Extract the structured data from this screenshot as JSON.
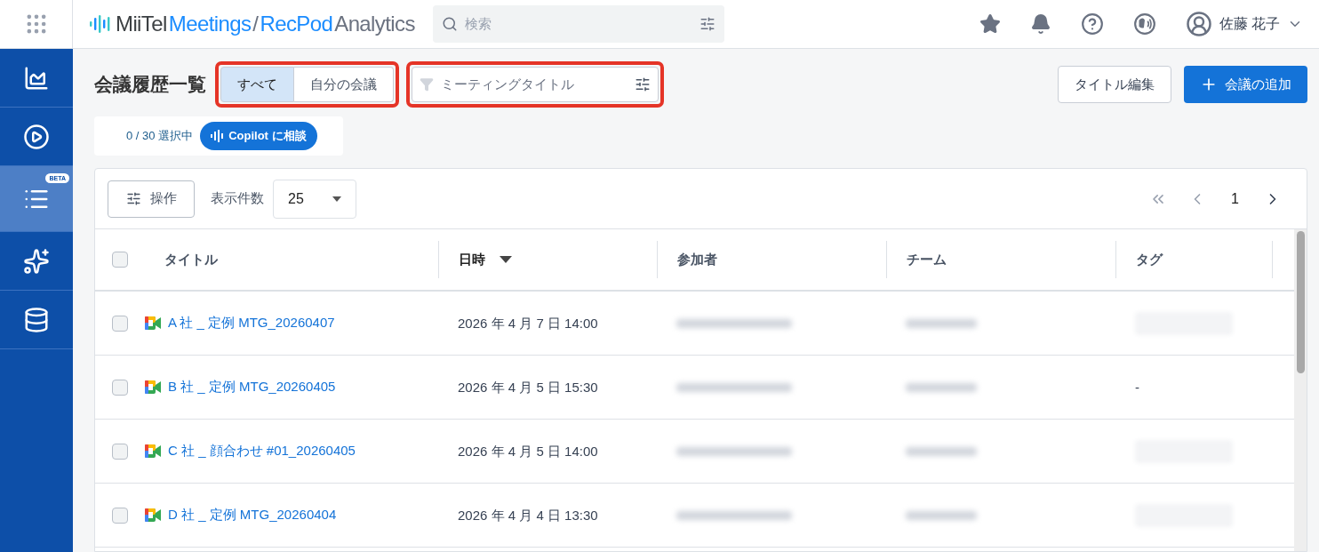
{
  "header": {
    "logo": [
      {
        "text": "MiiTel",
        "color": "#3c4043"
      },
      {
        "text": "Meetings",
        "color": "#1a8cff"
      },
      {
        "text": "/",
        "color": "#6b7280"
      },
      {
        "text": "RecPod",
        "color": "#1a8cff"
      },
      {
        "text": "Analytics",
        "color": "#6b7280"
      }
    ],
    "search": {
      "placeholder": "検索"
    },
    "user": {
      "name": "佐藤 花子"
    }
  },
  "sidebar": {
    "items": [
      {
        "selected": false
      },
      {
        "selected": false
      },
      {
        "selected": true,
        "badge": "BETA"
      },
      {
        "selected": false
      },
      {
        "selected": false
      }
    ]
  },
  "page": {
    "title": "会議履歴一覧",
    "scope_tabs": [
      {
        "label": "すべて",
        "selected": true
      },
      {
        "label": "自分の会議",
        "selected": false
      }
    ],
    "filter": {
      "placeholder": "ミーティングタイトル"
    },
    "buttons": [
      {
        "label": "タイトル編集",
        "kind": "outline"
      },
      {
        "label": "会議の追加",
        "kind": "primary"
      }
    ],
    "selection": {
      "count": "0 / 30 選択中",
      "copilot_button": "Copilot に相談"
    }
  },
  "table": {
    "actions_button": "操作",
    "page_size_label": "表示件数",
    "page_size": "25",
    "pagination": {
      "current": "1"
    },
    "select_all": {
      "checked": false
    },
    "columns": [
      {
        "label": "タイトル",
        "sorted": false
      },
      {
        "label": "日時",
        "sorted": true
      },
      {
        "label": "参加者",
        "sorted": false
      },
      {
        "label": "チーム",
        "sorted": false
      },
      {
        "label": "タグ",
        "sorted": false
      }
    ],
    "rows": [
      {
        "checked": false,
        "title": "A 社 _ 定例 MTG_20260407",
        "datetime": "2026 年 4 月 7 日 14:00"
      },
      {
        "checked": false,
        "title": "B 社 _ 定例 MTG_20260405",
        "datetime": "2026 年 4 月 5 日 15:30",
        "tag": "-"
      },
      {
        "checked": false,
        "title": "C 社 _ 顔合わせ #01_20260405",
        "datetime": "2026 年 4 月 5 日 14:00"
      },
      {
        "checked": false,
        "title": "D 社 _ 定例 MTG_20260404",
        "datetime": "2026 年 4 月 4 日 13:30"
      }
    ]
  }
}
